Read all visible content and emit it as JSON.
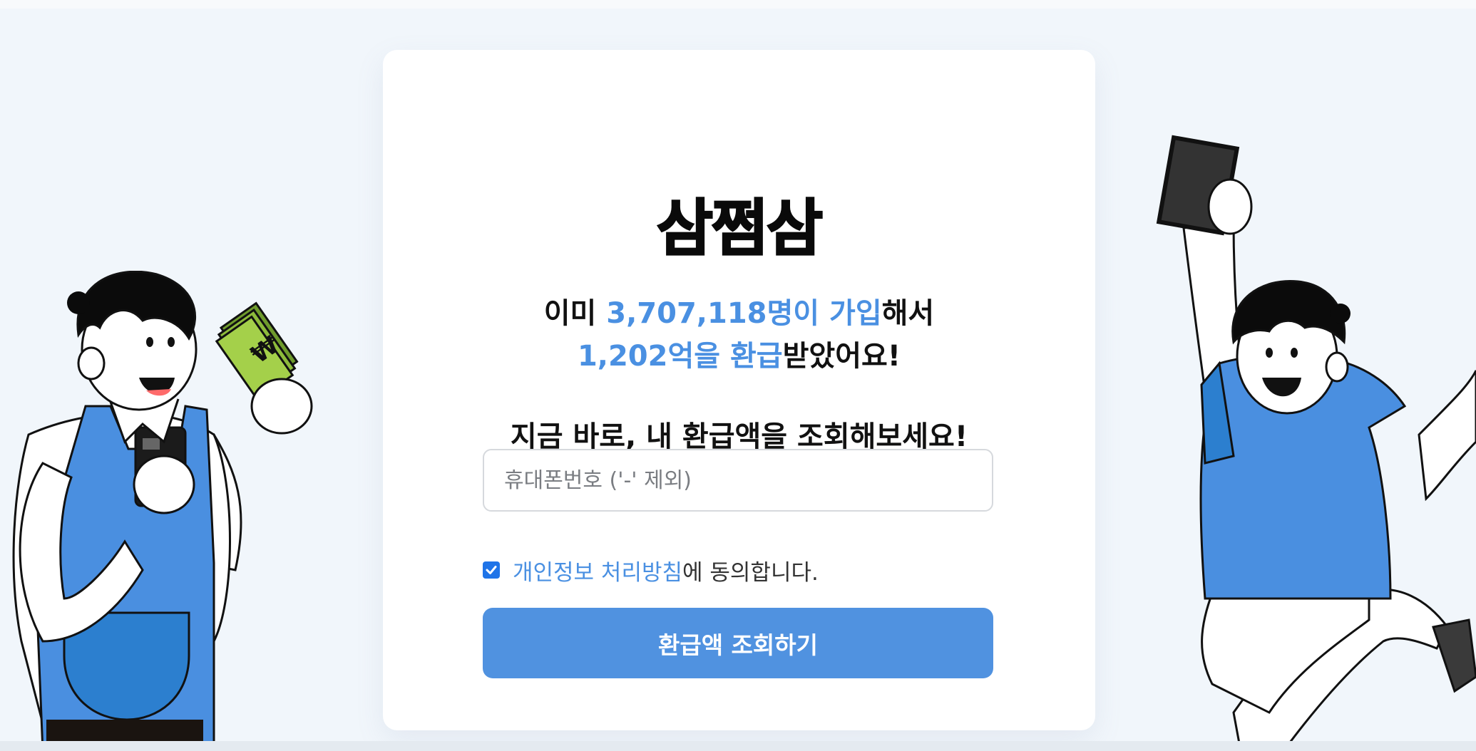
{
  "brand": {
    "logo_text": "삼쩜삼"
  },
  "headline": {
    "prefix": "이미 ",
    "members_accent": "3,707,118명이 가입",
    "members_suffix": "해서",
    "refund_accent": "1,202억을 환급",
    "refund_suffix": "받았어요!"
  },
  "subheadline": "지금 바로, 내 환급액을 조회해보세요!",
  "form": {
    "phone_placeholder": "휴대폰번호 ('-' 제외)",
    "phone_value": "",
    "consent": {
      "checked": true,
      "link_text": "개인정보 처리방침",
      "suffix_text": "에 동의합니다."
    },
    "submit_label": "환급액 조회하기"
  },
  "colors": {
    "accent": "#4a90e2",
    "button": "#5092e0",
    "checkbox": "#1f74e8",
    "background": "#f1f6fb",
    "apron": "#4a8fe0"
  },
  "illustrations": {
    "left_money_symbol": "₩"
  }
}
